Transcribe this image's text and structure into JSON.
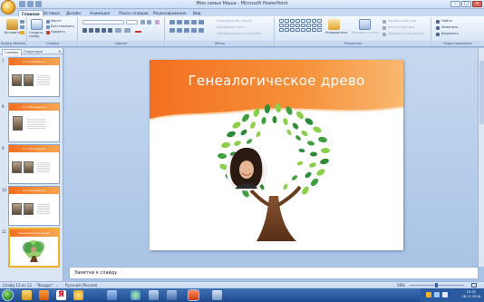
{
  "window": {
    "title": "Моя семья Маша - Microsoft PowerPoint",
    "controls": {
      "minimize": "–",
      "maximize": "□",
      "close": "✕"
    }
  },
  "ribbon_tabs": [
    {
      "label": "Главная",
      "active": true
    },
    {
      "label": "Вставка",
      "active": false
    },
    {
      "label": "Дизайн",
      "active": false
    },
    {
      "label": "Анимация",
      "active": false
    },
    {
      "label": "Показ слайдов",
      "active": false
    },
    {
      "label": "Рецензирование",
      "active": false
    },
    {
      "label": "Вид",
      "active": false
    }
  ],
  "ribbon": {
    "clipboard": {
      "group_label": "Буфер обмена",
      "paste": "Вставить"
    },
    "slides": {
      "group_label": "Слайды",
      "new_slide": "Создать слайд",
      "layout": "Макет",
      "reset": "Восстановить",
      "delete": "Удалить"
    },
    "font": {
      "group_label": "Шрифт"
    },
    "paragraph": {
      "group_label": "Абзац",
      "text_direction": "Направление текста",
      "align_text": "Выровнять текст",
      "smartart": "Преобразовать в SmartArt"
    },
    "drawing": {
      "group_label": "Рисование",
      "arrange": "Упорядочить",
      "quick_styles": "Экспресс-стили",
      "shape_fill": "Заливка фигуры",
      "shape_outline": "Контур фигуры",
      "shape_effects": "Эффекты для фигур"
    },
    "editing": {
      "group_label": "Редактирование",
      "find": "Найти",
      "replace": "Заменить",
      "select": "Выделить"
    }
  },
  "left_pane": {
    "tabs": [
      {
        "label": "Слайды",
        "active": true
      },
      {
        "label": "Структура",
        "active": false
      }
    ],
    "close": "x",
    "slides": [
      {
        "number": "7",
        "title": "Это моя бабушка",
        "selected": false
      },
      {
        "number": "8",
        "title": "Это мой дедушка",
        "selected": false
      },
      {
        "number": "9",
        "title": "Это мой дедушка",
        "selected": false
      },
      {
        "number": "10",
        "title": "Это моя бабушка",
        "selected": false
      },
      {
        "number": "11",
        "title": "Генеалогическое древо",
        "selected": true
      }
    ]
  },
  "slide": {
    "title": "Генеалогическое древо",
    "colors": {
      "header": "#f37021",
      "leaf_dark": "#2e8b3a",
      "leaf_light": "#8ccf4a",
      "trunk": "#6b3d1f"
    }
  },
  "notes": {
    "placeholder": "Заметки к слайду"
  },
  "status_bar": {
    "slide_info": "Слайд 12 из 12",
    "theme": "\"Воздух\"",
    "language": "Русский (Россия)",
    "zoom": "58%"
  },
  "taskbar": {
    "time": "10:35",
    "date": "28.11.2016",
    "icons": [
      "folder-icon",
      "media-player-icon",
      "yandex-browser-icon",
      "ie-icon",
      "network-icon",
      "paint-icon",
      "powerpoint-icon",
      "photo-icon",
      "settings-icon"
    ]
  }
}
